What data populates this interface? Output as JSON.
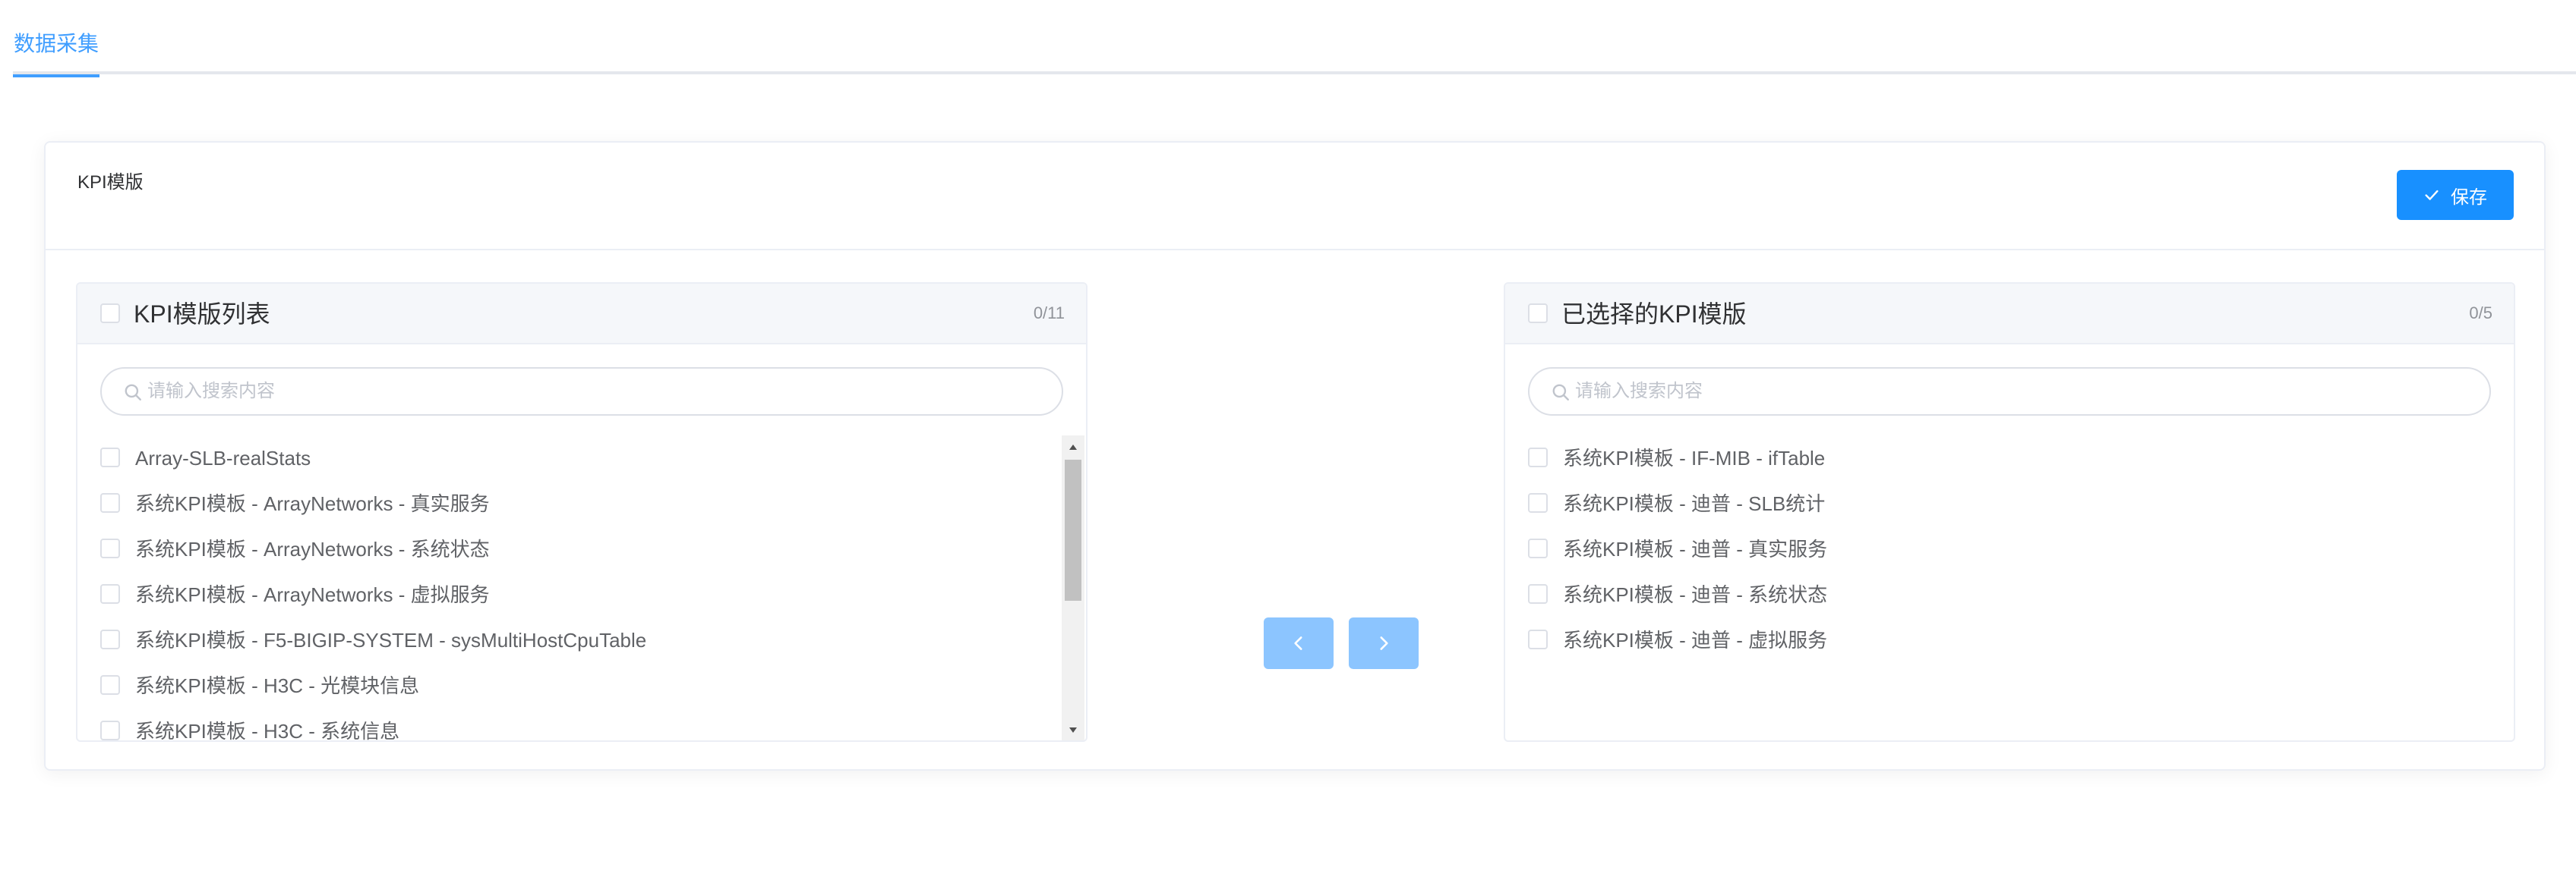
{
  "tabs": [
    {
      "label": "数据采集",
      "active": true
    }
  ],
  "card": {
    "title": "KPI模版",
    "save_label": "保存"
  },
  "colors": {
    "primary": "#1890ff",
    "tab_active": "#409eff",
    "button_disabled": "#8cc5ff",
    "border": "#ebeef5"
  },
  "left_panel": {
    "title": "KPI模版列表",
    "count": "0/11",
    "search_placeholder": "请输入搜索内容",
    "items": [
      "Array-SLB-realStats",
      "系统KPI模板 - ArrayNetworks - 真实服务",
      "系统KPI模板 - ArrayNetworks - 系统状态",
      "系统KPI模板 - ArrayNetworks - 虚拟服务",
      "系统KPI模板 - F5-BIGIP-SYSTEM - sysMultiHostCpuTable",
      "系统KPI模板 - H3C - 光模块信息",
      "系统KPI模板 - H3C - 系统信息"
    ]
  },
  "right_panel": {
    "title": "已选择的KPI模版",
    "count": "0/5",
    "search_placeholder": "请输入搜索内容",
    "items": [
      "系统KPI模板 - IF-MIB - ifTable",
      "系统KPI模板 - 迪普 - SLB统计",
      "系统KPI模板 - 迪普 - 真实服务",
      "系统KPI模板 - 迪普 - 系统状态",
      "系统KPI模板 - 迪普 - 虚拟服务"
    ]
  },
  "icons": {
    "save": "check-icon",
    "search": "search-icon",
    "move_left": "chevron-left-icon",
    "move_right": "chevron-right-icon",
    "scroll_up": "triangle-up-icon",
    "scroll_down": "triangle-down-icon"
  }
}
